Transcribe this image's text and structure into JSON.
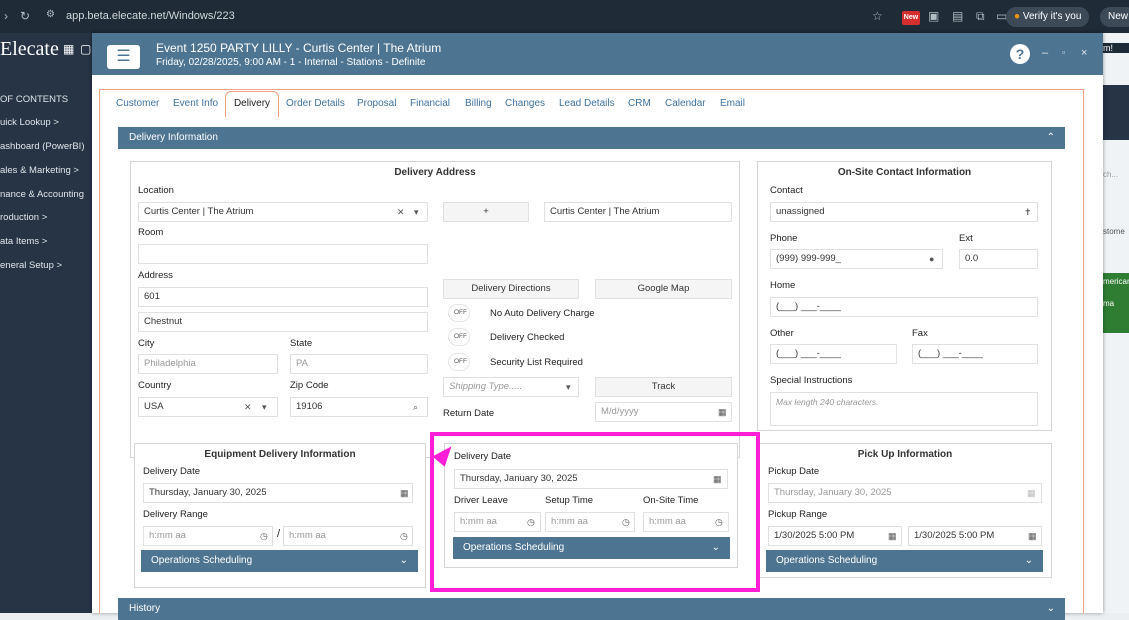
{
  "browser": {
    "url": "app.beta.elecate.net/Windows/223",
    "badge": "New",
    "profile": "Verify it's you",
    "newtab": "New"
  },
  "app": {
    "logo": "Elecate",
    "sidebar": [
      "OF CONTENTS",
      "uick Lookup  >",
      "ashboard (PowerBI)",
      "ales & Marketing  >",
      "nance & Accounting",
      "roduction  >",
      "ata Items  >",
      "eneral Setup  >"
    ],
    "right_fragments": [
      "ch...",
      "stome",
      "merican",
      "ma",
      "m!"
    ]
  },
  "modal": {
    "title": "Event 1250 PARTY LILLY - Curtis Center | The Atrium",
    "subtitle": "Friday, 02/28/2025, 9:00 AM - 1 - Internal - Stations - Definite",
    "help": "?"
  },
  "tabs": [
    "Customer",
    "Event Info",
    "Delivery",
    "Order Details",
    "Proposal",
    "Financial",
    "Billing",
    "Changes",
    "Lead Details",
    "CRM",
    "Calendar",
    "Email"
  ],
  "section": {
    "title": "Delivery Information",
    "history": "History"
  },
  "address": {
    "title": "Delivery Address",
    "location_label": "Location",
    "location_value": "Curtis Center | The Atrium",
    "add": "+",
    "location_name": "Curtis Center | The Atrium",
    "room_label": "Room",
    "address_label": "Address",
    "address1": "601",
    "address2": "Chestnut",
    "city_label": "City",
    "city": "Philadelphia",
    "state_label": "State",
    "state": "PA",
    "country_label": "Country",
    "country": "USA",
    "zip_label": "Zip Code",
    "zip": "19106",
    "directions": "Delivery Directions",
    "google": "Google Map",
    "off": "OFF",
    "toggle1": "No Auto Delivery Charge",
    "toggle2": "Delivery Checked",
    "toggle3": "Security List Required",
    "shipping_ph": "Shipping Type.....",
    "track": "Track",
    "return_label": "Return Date",
    "return_ph": "M/d/yyyy"
  },
  "contact": {
    "title": "On-Site Contact Information",
    "contact_label": "Contact",
    "contact_value": "unassigned",
    "phone_label": "Phone",
    "phone": "(999) 999-999_",
    "ext_label": "Ext",
    "ext": "0.0",
    "home_label": "Home",
    "home": "(___) ___-____",
    "other_label": "Other",
    "other": "(___) ___-____",
    "fax_label": "Fax",
    "fax": "(___) ___-____",
    "instr_label": "Special Instructions",
    "instr_ph": "Max length 240 characters."
  },
  "equipment": {
    "title": "Equipment Delivery Information",
    "date_label": "Delivery Date",
    "date": "Thursday, January 30, 2025",
    "range_label": "Delivery Range",
    "time_ph": "h:mm aa",
    "sep": "/",
    "ops": "Operations Scheduling"
  },
  "middle": {
    "date_label": "Delivery Date",
    "date": "Thursday, January 30, 2025",
    "leave_label": "Driver Leave",
    "setup_label": "Setup Time",
    "onsite_label": "On-Site Time",
    "time_ph": "h:mm aa",
    "ops": "Operations Scheduling"
  },
  "pickup": {
    "title": "Pick Up Information",
    "date_label": "Pickup Date",
    "date": "Thursday, January 30, 2025",
    "range_label": "Pickup Range",
    "from": "1/30/2025 5:00 PM",
    "to": "1/30/2025 5:00 PM",
    "ops": "Operations Scheduling"
  }
}
